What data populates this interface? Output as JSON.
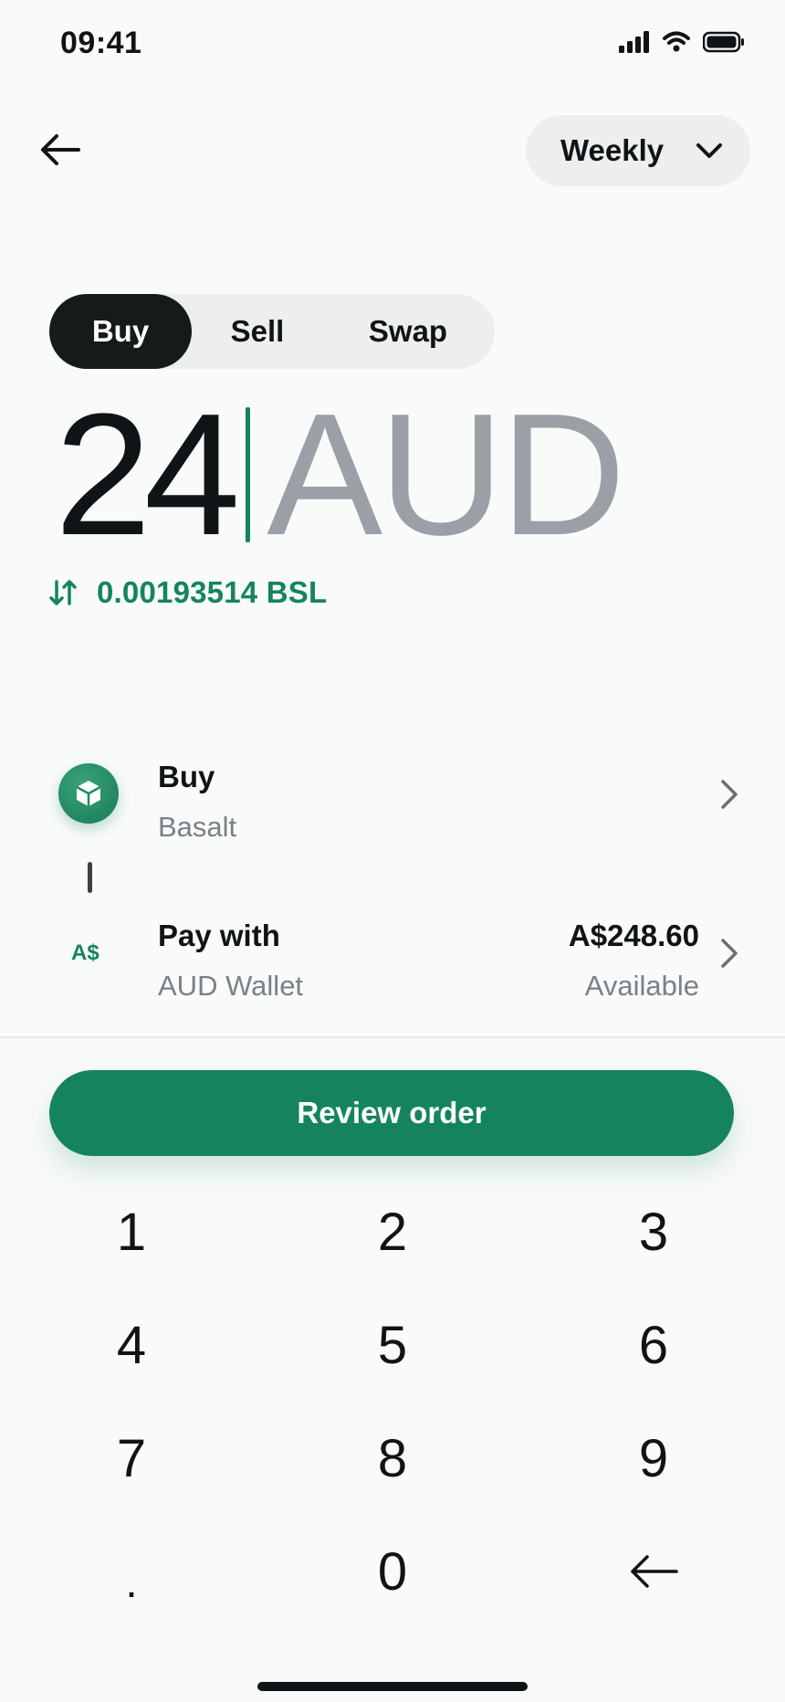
{
  "status_bar": {
    "time": "09:41"
  },
  "header": {
    "frequency": "Weekly"
  },
  "tabs": [
    {
      "label": "Buy",
      "active": true
    },
    {
      "label": "Sell",
      "active": false
    },
    {
      "label": "Swap",
      "active": false
    }
  ],
  "amount": {
    "value": "24",
    "currency": "AUD"
  },
  "conversion": {
    "text": "0.00193514 BSL"
  },
  "buy_row": {
    "title": "Buy",
    "subtitle": "Basalt"
  },
  "pay_row": {
    "title": "Pay with",
    "subtitle": "AUD Wallet",
    "badge": "A$",
    "balance": "A$248.60",
    "balance_label": "Available"
  },
  "cta": {
    "label": "Review order"
  },
  "keypad": [
    "1",
    "2",
    "3",
    "4",
    "5",
    "6",
    "7",
    "8",
    "9",
    ".",
    "0"
  ],
  "colors": {
    "accent": "#15845e",
    "dark": "#151a1b",
    "muted": "#9aa0a6"
  },
  "icons": {
    "back": "arrow-left-icon",
    "dropdown": "chevron-down-icon",
    "swap": "swap-vertical-icon",
    "asset": "cube-icon",
    "row_chevron": "chevron-right-icon",
    "delete": "backspace-arrow-icon"
  }
}
